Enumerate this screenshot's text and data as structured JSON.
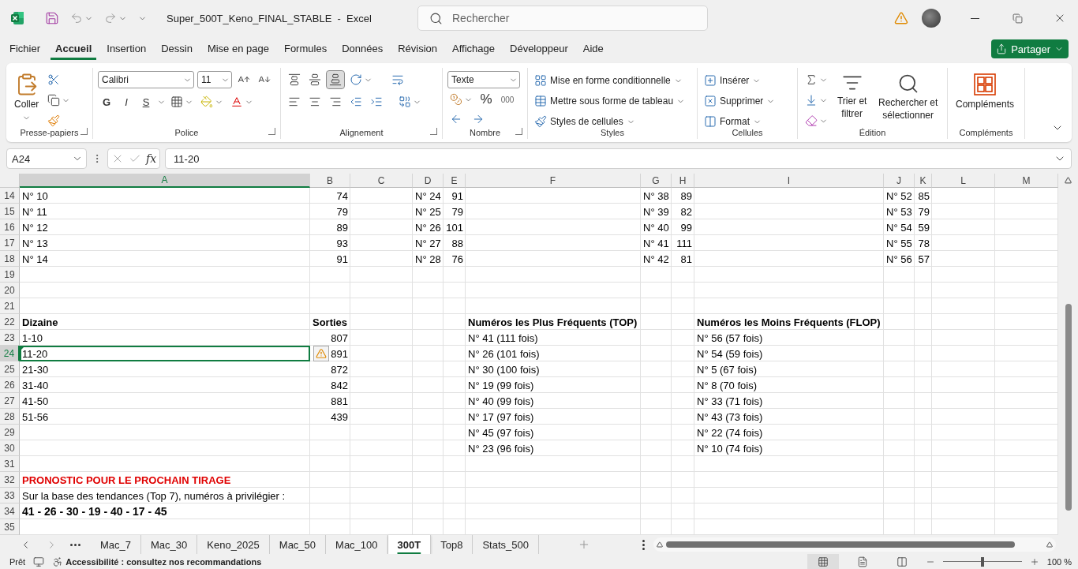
{
  "window": {
    "title": "Super_500T_Keno_FINAL_STABLE  -  Excel",
    "search_placeholder": "Rechercher"
  },
  "menu": {
    "tabs": [
      {
        "label": "Fichier",
        "selected": false
      },
      {
        "label": "Accueil",
        "selected": true
      },
      {
        "label": "Insertion",
        "selected": false
      },
      {
        "label": "Dessin",
        "selected": false
      },
      {
        "label": "Mise en page",
        "selected": false
      },
      {
        "label": "Formules",
        "selected": false
      },
      {
        "label": "Données",
        "selected": false
      },
      {
        "label": "Révision",
        "selected": false
      },
      {
        "label": "Affichage",
        "selected": false
      },
      {
        "label": "Développeur",
        "selected": false
      },
      {
        "label": "Aide",
        "selected": false
      }
    ],
    "share": "Partager"
  },
  "ribbon": {
    "clipboard": {
      "paste": "Coller",
      "label": "Presse-papiers"
    },
    "font": {
      "face": "Calibri",
      "size": "11",
      "bold": "G",
      "italic": "I",
      "underline": "S",
      "label": "Police"
    },
    "alignment": {
      "label": "Alignement",
      "bottom_align_selected": true
    },
    "number": {
      "format": "Texte",
      "percent": "%",
      "thousands": "000",
      "label": "Nombre"
    },
    "styles": {
      "items": [
        "Mise en forme conditionnelle",
        "Mettre sous forme de tableau",
        "Styles de cellules"
      ],
      "label": "Styles"
    },
    "cells": {
      "items": [
        "Insérer",
        "Supprimer",
        "Format"
      ],
      "label": "Cellules"
    },
    "editing": {
      "sort": "Trier et filtrer",
      "find": "Rechercher et sélectionner",
      "label": "Édition"
    },
    "addins": {
      "button": "Compléments",
      "label": "Compléments"
    }
  },
  "formula_bar": {
    "name_box": "A24",
    "fx": "fx",
    "value": "11-20"
  },
  "sheet": {
    "error_flag": true,
    "columns": [
      {
        "letter": "A",
        "selected": true
      },
      {
        "letter": "B",
        "selected": false
      },
      {
        "letter": "C",
        "selected": false
      },
      {
        "letter": "D",
        "selected": false
      },
      {
        "letter": "E",
        "selected": false
      },
      {
        "letter": "F",
        "selected": false
      },
      {
        "letter": "G",
        "selected": false
      },
      {
        "letter": "H",
        "selected": false
      },
      {
        "letter": "I",
        "selected": false
      },
      {
        "letter": "J",
        "selected": false
      },
      {
        "letter": "K",
        "selected": false
      },
      {
        "letter": "L",
        "selected": false
      },
      {
        "letter": "M",
        "selected": false
      }
    ],
    "rows": [
      {
        "number": "14",
        "selected": false,
        "cells": {
          "A": {
            "text": "N° 10"
          },
          "B": {
            "text": "74",
            "kind": "number"
          },
          "D": {
            "text": "N° 24"
          },
          "E": {
            "text": "91",
            "kind": "number"
          },
          "G": {
            "text": "N° 38"
          },
          "H": {
            "text": "89",
            "kind": "number"
          },
          "J": {
            "text": "N° 52"
          },
          "K": {
            "text": "85",
            "kind": "number"
          }
        }
      },
      {
        "number": "15",
        "selected": false,
        "cells": {
          "A": {
            "text": "N° 11"
          },
          "B": {
            "text": "79",
            "kind": "number"
          },
          "D": {
            "text": "N° 25"
          },
          "E": {
            "text": "79",
            "kind": "number"
          },
          "G": {
            "text": "N° 39"
          },
          "H": {
            "text": "82",
            "kind": "number"
          },
          "J": {
            "text": "N° 53"
          },
          "K": {
            "text": "79",
            "kind": "number"
          }
        }
      },
      {
        "number": "16",
        "selected": false,
        "cells": {
          "A": {
            "text": "N° 12"
          },
          "B": {
            "text": "89",
            "kind": "number"
          },
          "D": {
            "text": "N° 26"
          },
          "E": {
            "text": "101",
            "kind": "number"
          },
          "G": {
            "text": "N° 40"
          },
          "H": {
            "text": "99",
            "kind": "number"
          },
          "J": {
            "text": "N° 54"
          },
          "K": {
            "text": "59",
            "kind": "number"
          }
        }
      },
      {
        "number": "17",
        "selected": false,
        "cells": {
          "A": {
            "text": "N° 13"
          },
          "B": {
            "text": "93",
            "kind": "number"
          },
          "D": {
            "text": "N° 27"
          },
          "E": {
            "text": "88",
            "kind": "number"
          },
          "G": {
            "text": "N° 41"
          },
          "H": {
            "text": "111",
            "kind": "number"
          },
          "J": {
            "text": "N° 55"
          },
          "K": {
            "text": "78",
            "kind": "number"
          }
        }
      },
      {
        "number": "18",
        "selected": false,
        "cells": {
          "A": {
            "text": "N° 14"
          },
          "B": {
            "text": "91",
            "kind": "number"
          },
          "D": {
            "text": "N° 28"
          },
          "E": {
            "text": "76",
            "kind": "number"
          },
          "G": {
            "text": "N° 42"
          },
          "H": {
            "text": "81",
            "kind": "number"
          },
          "J": {
            "text": "N° 56"
          },
          "K": {
            "text": "57",
            "kind": "number"
          }
        }
      },
      {
        "number": "19",
        "selected": false
      },
      {
        "number": "20",
        "selected": false
      },
      {
        "number": "21",
        "selected": false
      },
      {
        "number": "22",
        "selected": false,
        "cells": {
          "A": {
            "text": "Dizaine",
            "kind": "heading"
          },
          "B": {
            "text": "Sorties",
            "kind": "heading"
          },
          "F": {
            "text": "Numéros les Plus Fréquents (TOP)",
            "kind": "heading"
          },
          "I": {
            "text": "Numéros les Moins Fréquents (FLOP)",
            "kind": "heading"
          }
        }
      },
      {
        "number": "23",
        "selected": false,
        "cells": {
          "A": {
            "text": "1-10"
          },
          "B": {
            "text": "807",
            "kind": "number"
          },
          "F": {
            "text": "N° 41 (111 fois)"
          },
          "I": {
            "text": "N° 56 (57 fois)"
          }
        }
      },
      {
        "number": "24",
        "selected": true,
        "cells": {
          "A": {
            "text": "11-20"
          },
          "B": {
            "text": "891",
            "kind": "number"
          },
          "F": {
            "text": "N° 26 (101 fois)"
          },
          "I": {
            "text": "N° 54 (59 fois)"
          }
        }
      },
      {
        "number": "25",
        "selected": false,
        "cells": {
          "A": {
            "text": "21-30"
          },
          "B": {
            "text": "872",
            "kind": "number"
          },
          "F": {
            "text": "N° 30 (100 fois)"
          },
          "I": {
            "text": "N° 5 (67 fois)"
          }
        }
      },
      {
        "number": "26",
        "selected": false,
        "cells": {
          "A": {
            "text": "31-40"
          },
          "B": {
            "text": "842",
            "kind": "number"
          },
          "F": {
            "text": "N° 19 (99 fois)"
          },
          "I": {
            "text": "N° 8 (70 fois)"
          }
        }
      },
      {
        "number": "27",
        "selected": false,
        "cells": {
          "A": {
            "text": "41-50"
          },
          "B": {
            "text": "881",
            "kind": "number"
          },
          "F": {
            "text": "N° 40 (99 fois)"
          },
          "I": {
            "text": "N° 33 (71 fois)"
          }
        }
      },
      {
        "number": "28",
        "selected": false,
        "cells": {
          "A": {
            "text": "51-56"
          },
          "B": {
            "text": "439",
            "kind": "number"
          },
          "F": {
            "text": "N° 17 (97 fois)"
          },
          "I": {
            "text": "N° 43 (73 fois)"
          }
        }
      },
      {
        "number": "29",
        "selected": false,
        "cells": {
          "F": {
            "text": "N° 45 (97 fois)"
          },
          "I": {
            "text": "N° 22 (74 fois)"
          }
        }
      },
      {
        "number": "30",
        "selected": false,
        "cells": {
          "F": {
            "text": "N° 23 (96 fois)"
          },
          "I": {
            "text": "N° 10 (74 fois)"
          }
        }
      },
      {
        "number": "31",
        "selected": false
      },
      {
        "number": "32",
        "selected": false,
        "cells": {
          "A": {
            "text": "PRONOSTIC POUR LE PROCHAIN TIRAGE",
            "kind": "alert"
          }
        }
      },
      {
        "number": "33",
        "selected": false,
        "cells": {
          "A": {
            "text": "Sur la base des tendances (Top 7), numéros à privilégier :"
          }
        }
      },
      {
        "number": "34",
        "selected": false,
        "cells": {
          "A": {
            "text": "41 - 26 - 30 - 19 - 40 - 17 - 45",
            "kind": "strong"
          }
        }
      },
      {
        "number": "35",
        "selected": false
      }
    ]
  },
  "sheet_tabs": [
    {
      "label": "Mac_7",
      "selected": false
    },
    {
      "label": "Mac_30",
      "selected": false
    },
    {
      "label": "Keno_2025",
      "selected": false
    },
    {
      "label": "Mac_50",
      "selected": false
    },
    {
      "label": "Mac_100",
      "selected": false
    },
    {
      "label": "300T",
      "selected": true
    },
    {
      "label": "Top8",
      "selected": false
    },
    {
      "label": "Stats_500",
      "selected": false
    }
  ],
  "status_bar": {
    "mode": "Prêt",
    "accessibility": "Accessibilité : consultez nos recommandations",
    "zoom": "100 %",
    "zoom_slider": {
      "level": 0.5
    }
  }
}
